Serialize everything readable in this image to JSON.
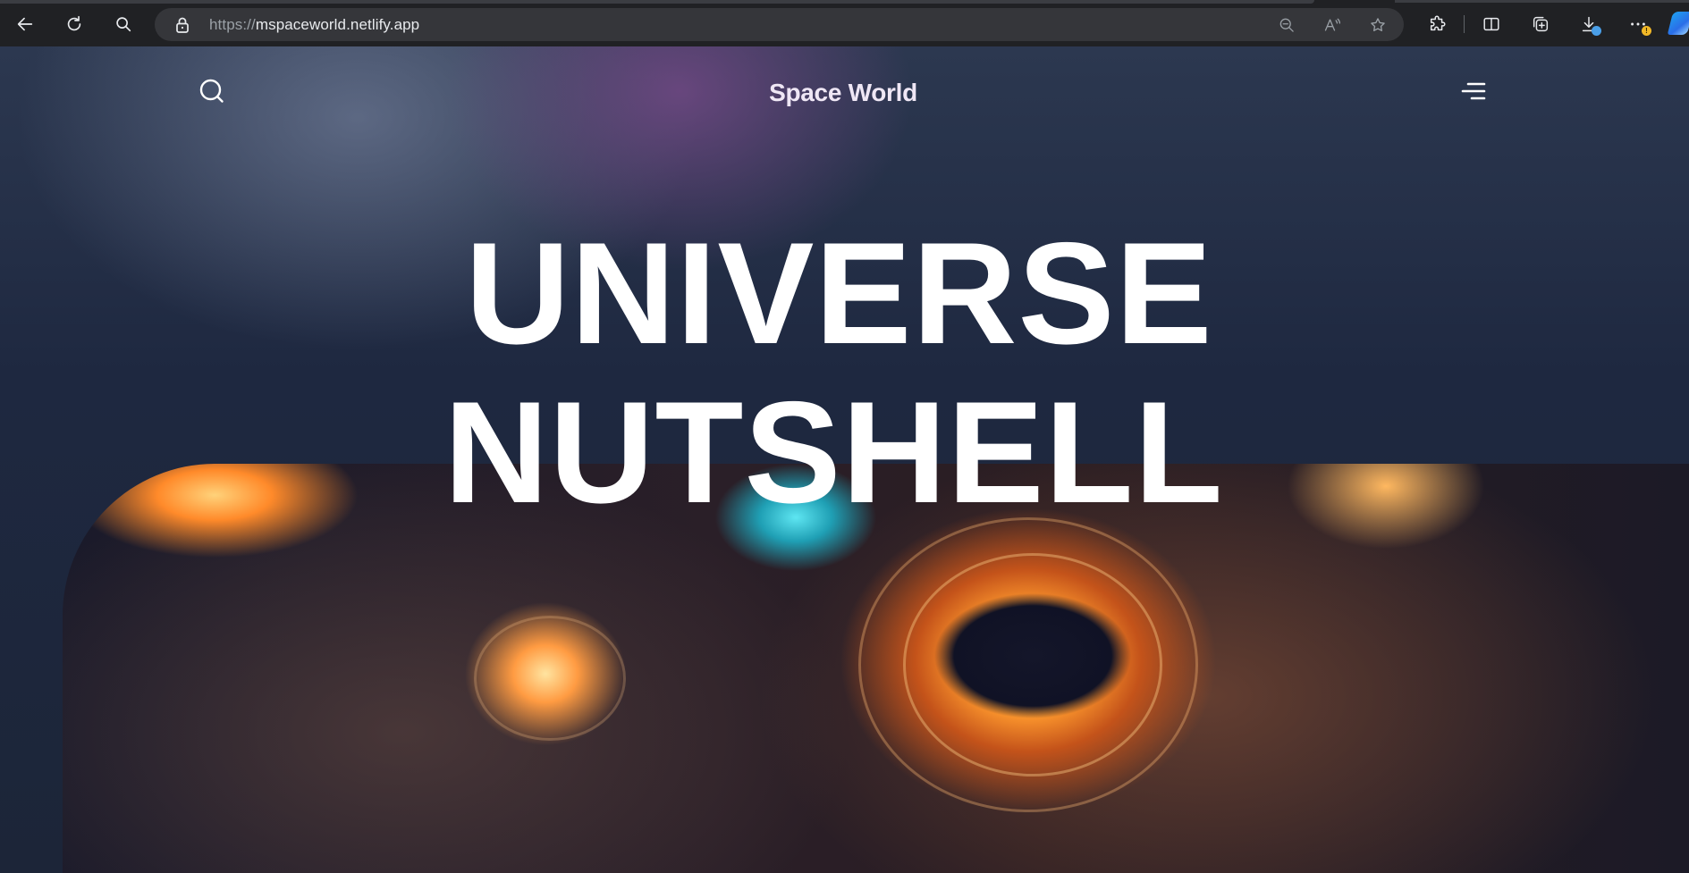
{
  "browser": {
    "url_protocol": "https://",
    "url_host": "mspaceworld.netlify.app",
    "icons": {
      "back": "back-arrow-icon",
      "refresh": "refresh-icon",
      "search": "search-icon",
      "lock": "lock-icon",
      "zoom_out": "zoom-out-icon",
      "read_aloud": "read-aloud-icon",
      "favorite": "star-icon",
      "extensions": "puzzle-icon",
      "split_screen": "split-screen-icon",
      "collections": "collections-icon",
      "downloads": "download-icon",
      "more": "more-icon",
      "copilot": "copilot-icon"
    },
    "colors": {
      "toolbar": "#202124",
      "address_bar": "#35363a",
      "download_badge": "#4a9fe8",
      "more_badge": "#f2b827"
    }
  },
  "site": {
    "title": "Space World",
    "icons": {
      "search": "search-icon",
      "menu": "hamburger-menu-icon"
    }
  },
  "hero": {
    "line1": "UNIVERSE",
    "line2": "NUTSHELL",
    "image": "black-hole-galaxy-illustration"
  },
  "colors": {
    "page_background": "#1d2538",
    "title_color": "#efe7f5",
    "headline_color": "#ffffff"
  }
}
